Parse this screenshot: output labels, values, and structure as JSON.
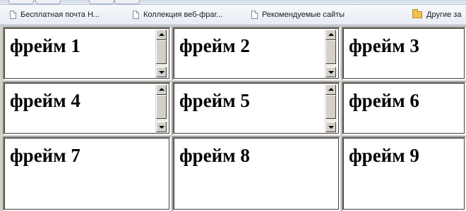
{
  "bookmarks": [
    {
      "label": "Бесплатная почта Н...",
      "icon": "page-icon"
    },
    {
      "label": "Коллекция веб-фраг...",
      "icon": "page-icon"
    },
    {
      "label": "Рекомендуемые сайты",
      "icon": "page-icon"
    },
    {
      "label": "Другие за",
      "icon": "folder-icon"
    }
  ],
  "frames": [
    {
      "title": "фрейм 1",
      "scrollbar": true
    },
    {
      "title": "фрейм 2",
      "scrollbar": true
    },
    {
      "title": "фрейм 3",
      "scrollbar": false
    },
    {
      "title": "фрейм 4",
      "scrollbar": true
    },
    {
      "title": "фрейм 5",
      "scrollbar": true
    },
    {
      "title": "фрейм 6",
      "scrollbar": false
    },
    {
      "title": "фрейм 7",
      "scrollbar": false
    },
    {
      "title": "фрейм 8",
      "scrollbar": false
    },
    {
      "title": "фрейм 9",
      "scrollbar": false
    }
  ],
  "colors": {
    "frame_border": "#808080",
    "frame_background": "#ffffff",
    "scrollbar_face": "#d4d0c8",
    "folder": "#f2c14e"
  }
}
